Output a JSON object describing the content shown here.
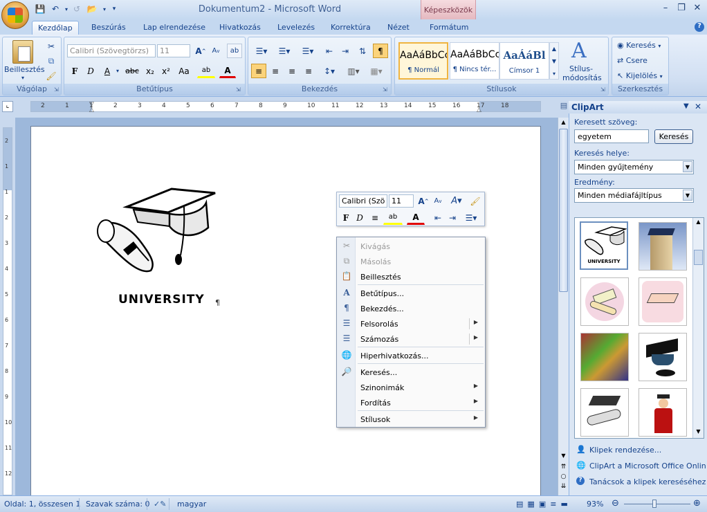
{
  "window": {
    "title": "Dokumentum2 - Microsoft Word",
    "contextual_tab": "Képeszközök"
  },
  "qat": {
    "save_icon": "save-icon",
    "undo_icon": "undo-icon",
    "redo_icon": "redo-icon",
    "open_icon": "open-icon"
  },
  "tabs": [
    "Kezdőlap",
    "Beszúrás",
    "Lap elrendezése",
    "Hivatkozás",
    "Levelezés",
    "Korrektúra",
    "Nézet",
    "Formátum"
  ],
  "ribbon": {
    "clipboard": {
      "label": "Vágólap",
      "paste": "Beillesztés"
    },
    "font": {
      "label": "Betűtípus",
      "font_name": "Calibri (Szövegtörzs)",
      "font_size": "11",
      "bold": "F",
      "italic": "D",
      "underline": "A",
      "strike": "abc",
      "sub": "x₂",
      "sup": "x²",
      "case": "Aa"
    },
    "paragraph": {
      "label": "Bekezdés"
    },
    "styles": {
      "label": "Stílusok",
      "preview1": "AaÁáBbCc",
      "preview2": "AaÁáBbCc",
      "preview3": "AaÁáBl",
      "style1": "¶ Normál",
      "style2": "¶ Nincs tér...",
      "style3": "Címsor 1",
      "change_styles_1": "Stílus-",
      "change_styles_2": "módosítás"
    },
    "editing": {
      "label": "Szerkesztés",
      "find": "Keresés",
      "replace": "Csere",
      "select": "Kijelölés"
    }
  },
  "ruler": {
    "numbers": [
      "2",
      "1",
      "1",
      "2",
      "3",
      "4",
      "5",
      "6",
      "7",
      "8",
      "9",
      "10",
      "11",
      "12",
      "13",
      "14",
      "15",
      "16",
      "17",
      "18"
    ]
  },
  "vruler": {
    "numbers": [
      "2",
      "1",
      "1",
      "2",
      "3",
      "4",
      "5",
      "6",
      "7",
      "8",
      "9",
      "10",
      "11",
      "12"
    ]
  },
  "document": {
    "image_caption": "UNIVERSITY",
    "pilcrow": "¶"
  },
  "minitoolbar": {
    "font_name": "Calibri (Szö",
    "font_size": "11",
    "bold": "F",
    "italic": "D"
  },
  "context_menu": {
    "items": [
      {
        "label": "Kivágás",
        "icon": "scissors-icon",
        "disabled": true
      },
      {
        "label": "Másolás",
        "icon": "copy-icon",
        "disabled": true
      },
      {
        "label": "Beillesztés",
        "icon": "paste-icon",
        "disabled": false
      },
      {
        "label": "Betűtípus...",
        "icon": "font-icon",
        "disabled": false
      },
      {
        "label": "Bekezdés...",
        "icon": "paragraph-icon",
        "disabled": false
      },
      {
        "label": "Felsorolás",
        "icon": "bullets-icon",
        "disabled": false,
        "submenu": true
      },
      {
        "label": "Számozás",
        "icon": "numbering-icon",
        "disabled": false,
        "submenu": true
      },
      {
        "label": "Hiperhivatkozás...",
        "icon": "hyperlink-icon",
        "disabled": false
      },
      {
        "label": "Keresés...",
        "icon": "research-icon",
        "disabled": false
      },
      {
        "label": "Szinonimák",
        "icon": "",
        "disabled": false,
        "submenu": true
      },
      {
        "label": "Fordítás",
        "icon": "",
        "disabled": false,
        "submenu": true
      },
      {
        "label": "Stílusok",
        "icon": "",
        "disabled": false,
        "submenu": true
      }
    ]
  },
  "clipart": {
    "title": "ClipArt",
    "search_label": "Keresett szöveg:",
    "search_value": "egyetem",
    "search_button": "Keresés",
    "location_label": "Keresés helye:",
    "location_value": "Minden gyűjtemény",
    "results_label": "Eredmény:",
    "results_value": "Minden médiafájltípus",
    "thumb1_caption": "UNIVERSITY",
    "links": [
      "Klipek rendezése...",
      "ClipArt a Microsoft Office Online webhelyen",
      "Tanácsok a klipek kereséséhez"
    ]
  },
  "status": {
    "page": "Oldal: 1, összesen 1",
    "words": "Szavak száma: 0",
    "language": "magyar",
    "zoom": "93%"
  }
}
